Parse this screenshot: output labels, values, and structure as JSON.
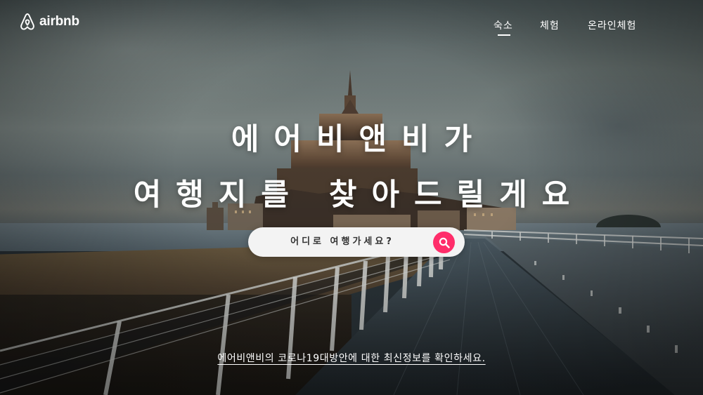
{
  "header": {
    "logo_text": "airbnb",
    "nav": [
      {
        "label": "숙소",
        "active": true
      },
      {
        "label": "체험",
        "active": false
      },
      {
        "label": "온라인체험",
        "active": false
      }
    ]
  },
  "hero": {
    "line1": "에어비앤비가",
    "line2": "여행지를 찾아드릴게요"
  },
  "search": {
    "placeholder": "어디로 여행가세요?",
    "button_icon": "search-icon",
    "button_color": "#ff2d6a"
  },
  "notice": {
    "link_text": "에어비앤비의 코로나19대방안에 대한 최신정보를 확인하세요."
  }
}
